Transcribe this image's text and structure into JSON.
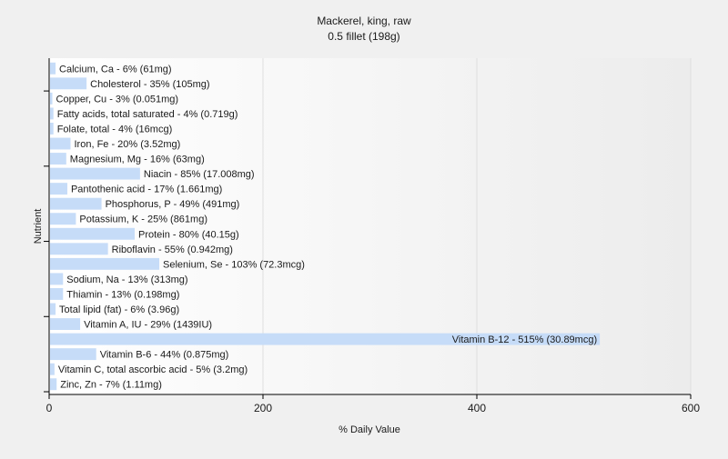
{
  "chart_data": {
    "type": "bar",
    "orientation": "horizontal",
    "title": "Mackerel, king, raw",
    "subtitle": "0.5 fillet (198g)",
    "xlabel": "% Daily Value",
    "ylabel": "Nutrient",
    "xlim": [
      0,
      600
    ],
    "x_ticks": [
      "0",
      "200",
      "400",
      "600"
    ],
    "grid": "vertical",
    "categories": [
      "Calcium, Ca",
      "Cholesterol",
      "Copper, Cu",
      "Fatty acids, total saturated",
      "Folate, total",
      "Iron, Fe",
      "Magnesium, Mg",
      "Niacin",
      "Pantothenic acid",
      "Phosphorus, P",
      "Potassium, K",
      "Protein",
      "Riboflavin",
      "Selenium, Se",
      "Sodium, Na",
      "Thiamin",
      "Total lipid (fat)",
      "Vitamin A, IU",
      "Vitamin B-12",
      "Vitamin B-6",
      "Vitamin C, total ascorbic acid",
      "Zinc, Zn"
    ],
    "values": [
      6,
      35,
      3,
      4,
      4,
      20,
      16,
      85,
      17,
      49,
      25,
      80,
      55,
      103,
      13,
      13,
      6,
      29,
      515,
      44,
      5,
      7
    ],
    "labels": [
      "Calcium, Ca - 6% (61mg)",
      "Cholesterol - 35% (105mg)",
      "Copper, Cu - 3% (0.051mg)",
      "Fatty acids, total saturated - 4% (0.719g)",
      "Folate, total - 4% (16mcg)",
      "Iron, Fe - 20% (3.52mg)",
      "Magnesium, Mg - 16% (63mg)",
      "Niacin - 85% (17.008mg)",
      "Pantothenic acid - 17% (1.661mg)",
      "Phosphorus, P - 49% (491mg)",
      "Potassium, K - 25% (861mg)",
      "Protein - 80% (40.15g)",
      "Riboflavin - 55% (0.942mg)",
      "Selenium, Se - 103% (72.3mcg)",
      "Sodium, Na - 13% (313mg)",
      "Thiamin - 13% (0.198mg)",
      "Total lipid (fat) - 6% (3.96g)",
      "Vitamin A, IU - 29% (1439IU)",
      "Vitamin B-12 - 515% (30.89mcg)",
      "Vitamin B-6 - 44% (0.875mg)",
      "Vitamin C, total ascorbic acid - 5% (3.2mg)",
      "Zinc, Zn - 7% (1.11mg)"
    ],
    "colors": {
      "bar": "#c6dcf8",
      "plot_background_start": "#ffffff",
      "plot_background_end": "#ececec",
      "page_background": "#f0f0f0",
      "grid": "#dedede",
      "axis": "#000000"
    }
  }
}
